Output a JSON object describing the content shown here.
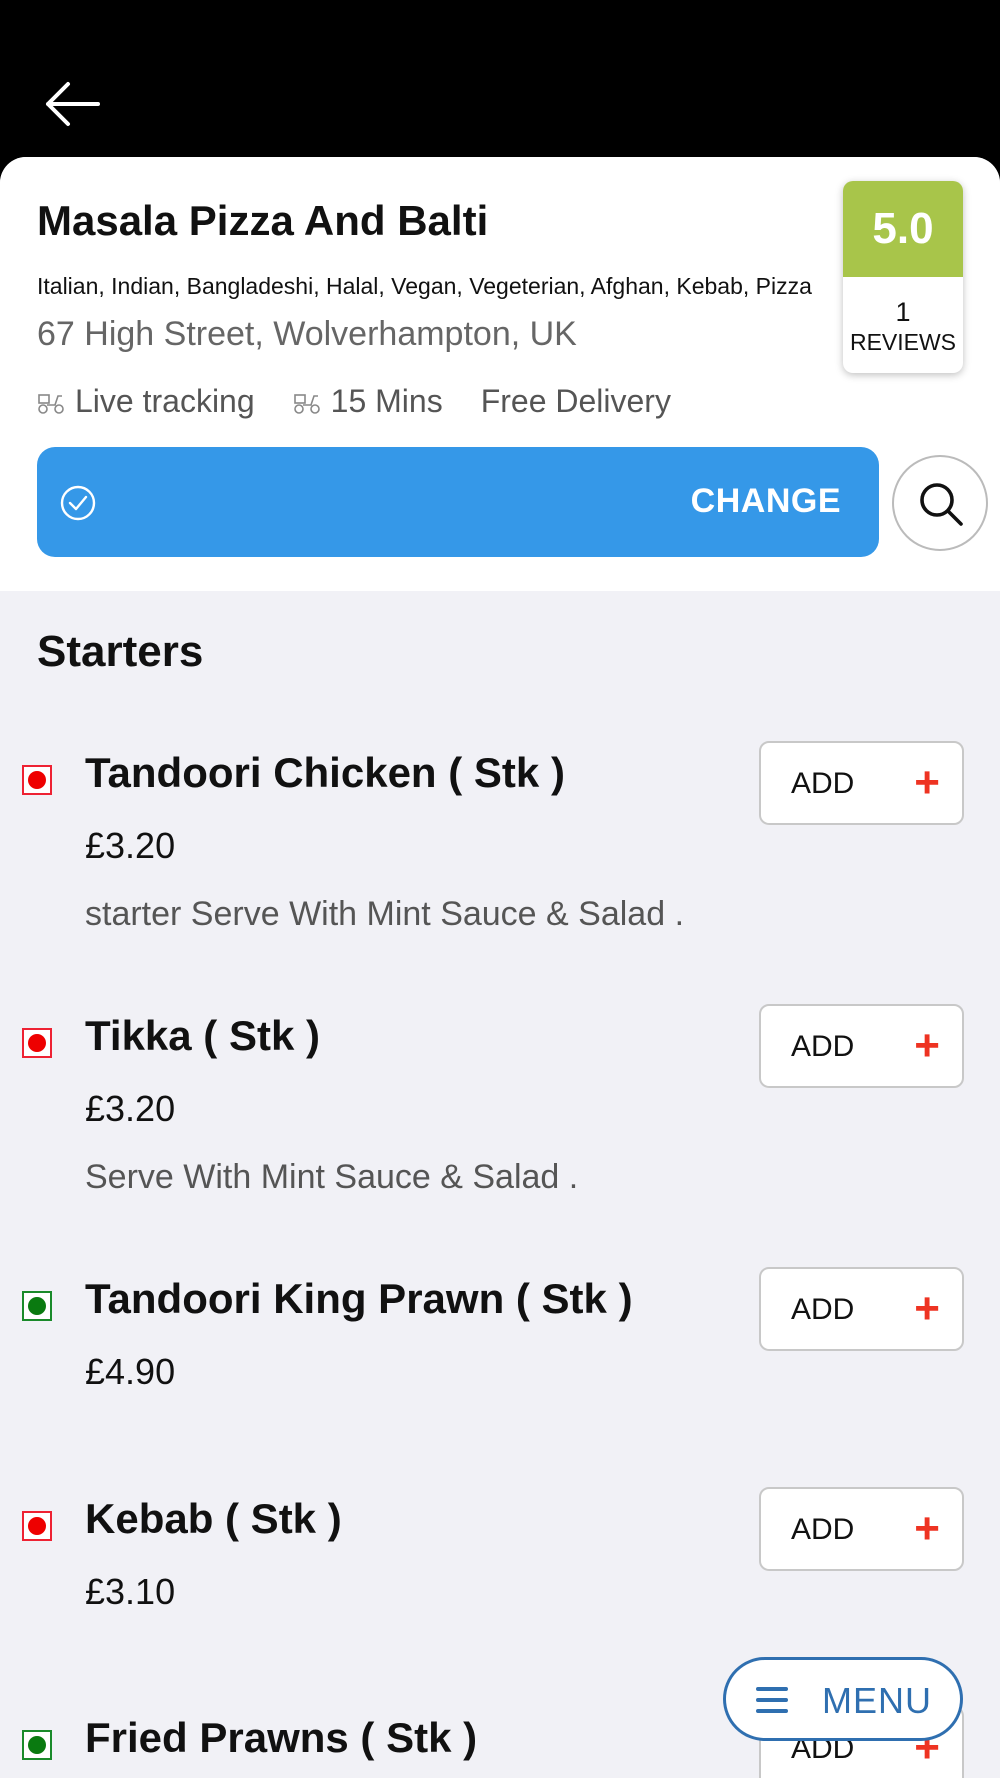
{
  "topbar": {
    "back_icon": "arrow-left-icon"
  },
  "restaurant": {
    "name": "Masala Pizza And Balti",
    "cuisines": "Italian, Indian, Bangladeshi, Halal, Vegan, Vegeterian, Afghan, Kebab, Pizza",
    "address": "67 High Street, Wolverhampton, UK",
    "live_tracking": "Live tracking",
    "delivery_time": "15 Mins",
    "delivery_fee": "Free Delivery"
  },
  "rating": {
    "score": "5.0",
    "count": "1",
    "label": "REVIEWS",
    "color": "#a8c54a"
  },
  "change_bar": {
    "label": "CHANGE",
    "color": "#3598e8"
  },
  "section": {
    "title": "Starters"
  },
  "items": [
    {
      "name": "Tandoori Chicken ( Stk )",
      "price": "£3.20",
      "description": "starter Serve With Mint Sauce & Salad .",
      "type": "non-veg"
    },
    {
      "name": "Tikka ( Stk )",
      "price": "£3.20",
      "description": "Serve With Mint Sauce & Salad .",
      "type": "non-veg"
    },
    {
      "name": "Tandoori King Prawn ( Stk )",
      "price": "£4.90",
      "description": "",
      "type": "veg"
    },
    {
      "name": "Kebab ( Stk )",
      "price": "£3.10",
      "description": "",
      "type": "non-veg"
    },
    {
      "name": "Fried Prawns ( Stk )",
      "price": "",
      "description": "",
      "type": "veg"
    }
  ],
  "add_button": {
    "label": "ADD",
    "plus": "+"
  },
  "menu_fab": {
    "label": "MENU",
    "icon": "hamburger-icon"
  }
}
